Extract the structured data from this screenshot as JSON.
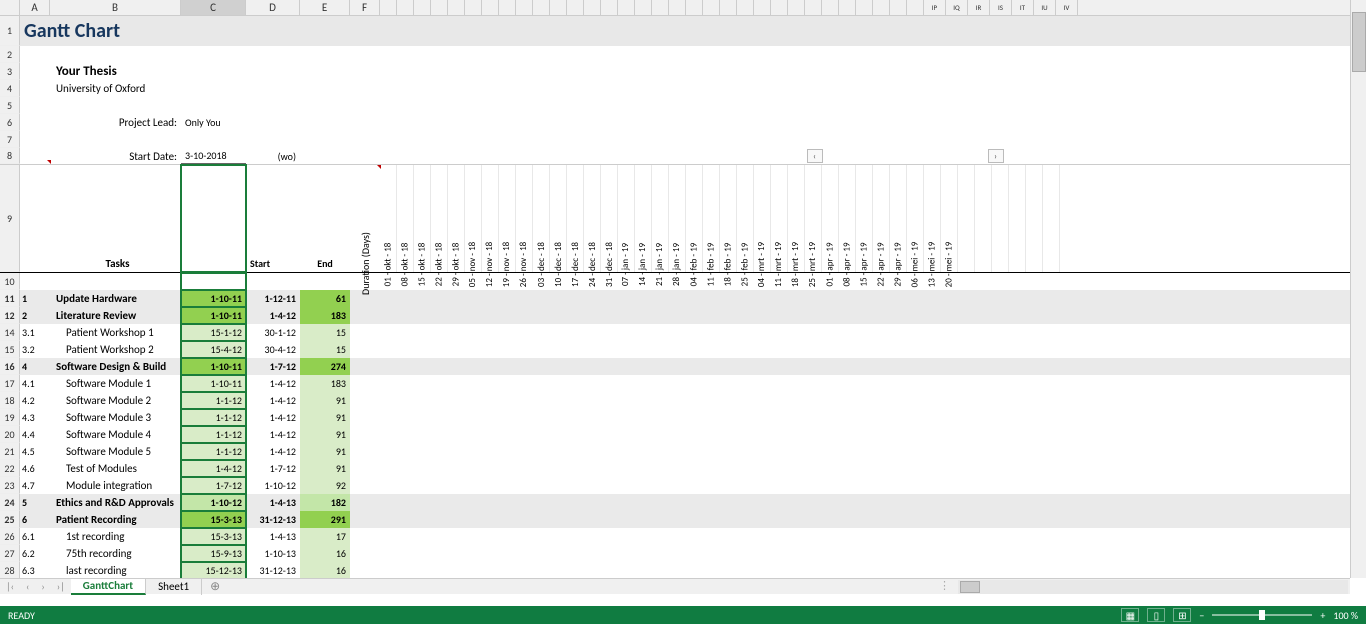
{
  "columns": [
    "A",
    "B",
    "C",
    "D",
    "E",
    "F"
  ],
  "extcols_compact": "compact",
  "extcols_end": [
    "IP",
    "IQ",
    "IR",
    "IS",
    "IT",
    "IU",
    "IV"
  ],
  "title": "Gantt Chart",
  "thesis_title": "Your Thesis",
  "university": "University of Oxford",
  "project_lead_label": "Project Lead:",
  "project_lead": "Only You",
  "start_date_label": "Start Date:",
  "start_date": "3-10-2018",
  "start_day": "(wo)",
  "headers": {
    "tasks": "Tasks",
    "start": "Start",
    "end": "End",
    "duration": "Duration (Days)"
  },
  "dates": [
    "01 - okt - 18",
    "08 - okt - 18",
    "15 - okt - 18",
    "22 - okt - 18",
    "29 - okt - 18",
    "05 - nov - 18",
    "12 - nov - 18",
    "19 - nov - 18",
    "26 - nov - 18",
    "03 - dec - 18",
    "10 - dec - 18",
    "17 - dec - 18",
    "24 - dec - 18",
    "31 - dec - 18",
    "07 - jan - 19",
    "14 - jan - 19",
    "21 - jan - 19",
    "28 - jan - 19",
    "04 - feb - 19",
    "11 - feb - 19",
    "18 - feb - 19",
    "25 - feb - 19",
    "04 - mrt - 19",
    "11 - mrt - 19",
    "18 - mrt - 19",
    "25 - mrt - 19",
    "01 - apr - 19",
    "08 - apr - 19",
    "15 - apr - 19",
    "22 - apr - 19",
    "29 - apr - 19",
    "06 - mei - 19",
    "13 - mei - 19",
    "20 - mei - 19"
  ],
  "tasks": [
    {
      "rn": "11",
      "id": "1",
      "name": "Update Hardware",
      "start": "1-10-11",
      "end": "1-12-11",
      "dur": "61",
      "sum": true,
      "g": "g1"
    },
    {
      "rn": "12",
      "id": "2",
      "name": "Literature Review",
      "start": "1-10-11",
      "end": "1-4-12",
      "dur": "183",
      "sum": true,
      "g": "g1"
    },
    {
      "rn": "14",
      "id": "3.1",
      "name": "Patient Workshop 1",
      "start": "15-1-12",
      "end": "30-1-12",
      "dur": "15",
      "sum": false,
      "g": "g3"
    },
    {
      "rn": "15",
      "id": "3.2",
      "name": "Patient Workshop 2",
      "start": "15-4-12",
      "end": "30-4-12",
      "dur": "15",
      "sum": false,
      "g": "g3"
    },
    {
      "rn": "16",
      "id": "4",
      "name": "Software Design & Build",
      "start": "1-10-11",
      "end": "1-7-12",
      "dur": "274",
      "sum": true,
      "g": "g1"
    },
    {
      "rn": "17",
      "id": "4.1",
      "name": "Software Module 1",
      "start": "1-10-11",
      "end": "1-4-12",
      "dur": "183",
      "sum": false,
      "g": "g3"
    },
    {
      "rn": "18",
      "id": "4.2",
      "name": "Software Module 2",
      "start": "1-1-12",
      "end": "1-4-12",
      "dur": "91",
      "sum": false,
      "g": "g3"
    },
    {
      "rn": "19",
      "id": "4.3",
      "name": "Software Module 3",
      "start": "1-1-12",
      "end": "1-4-12",
      "dur": "91",
      "sum": false,
      "g": "g3"
    },
    {
      "rn": "20",
      "id": "4.4",
      "name": "Software Module 4",
      "start": "1-1-12",
      "end": "1-4-12",
      "dur": "91",
      "sum": false,
      "g": "g3"
    },
    {
      "rn": "21",
      "id": "4.5",
      "name": "Software Module 5",
      "start": "1-1-12",
      "end": "1-4-12",
      "dur": "91",
      "sum": false,
      "g": "g3"
    },
    {
      "rn": "22",
      "id": "4.6",
      "name": "Test of Modules",
      "start": "1-4-12",
      "end": "1-7-12",
      "dur": "91",
      "sum": false,
      "g": "g3"
    },
    {
      "rn": "23",
      "id": "4.7",
      "name": "Module integration",
      "start": "1-7-12",
      "end": "1-10-12",
      "dur": "92",
      "sum": false,
      "g": "g3"
    },
    {
      "rn": "24",
      "id": "5",
      "name": "Ethics and R&D Approvals",
      "start": "1-10-12",
      "end": "1-4-13",
      "dur": "182",
      "sum": true,
      "g": "g2"
    },
    {
      "rn": "25",
      "id": "6",
      "name": "Patient Recording",
      "start": "15-3-13",
      "end": "31-12-13",
      "dur": "291",
      "sum": true,
      "g": "g1"
    },
    {
      "rn": "26",
      "id": "6.1",
      "name": "1st  recording",
      "start": "15-3-13",
      "end": "1-4-13",
      "dur": "17",
      "sum": false,
      "g": "g3"
    },
    {
      "rn": "27",
      "id": "6.2",
      "name": "75th recording",
      "start": "15-9-13",
      "end": "1-10-13",
      "dur": "16",
      "sum": false,
      "g": "g3"
    },
    {
      "rn": "28",
      "id": "6.3",
      "name": "last recording",
      "start": "15-12-13",
      "end": "31-12-13",
      "dur": "16",
      "sum": false,
      "g": "g3"
    }
  ],
  "tabs": {
    "active": "GanttChart",
    "other": "Sheet1"
  },
  "status": {
    "ready": "READY",
    "zoom": "100 %"
  }
}
